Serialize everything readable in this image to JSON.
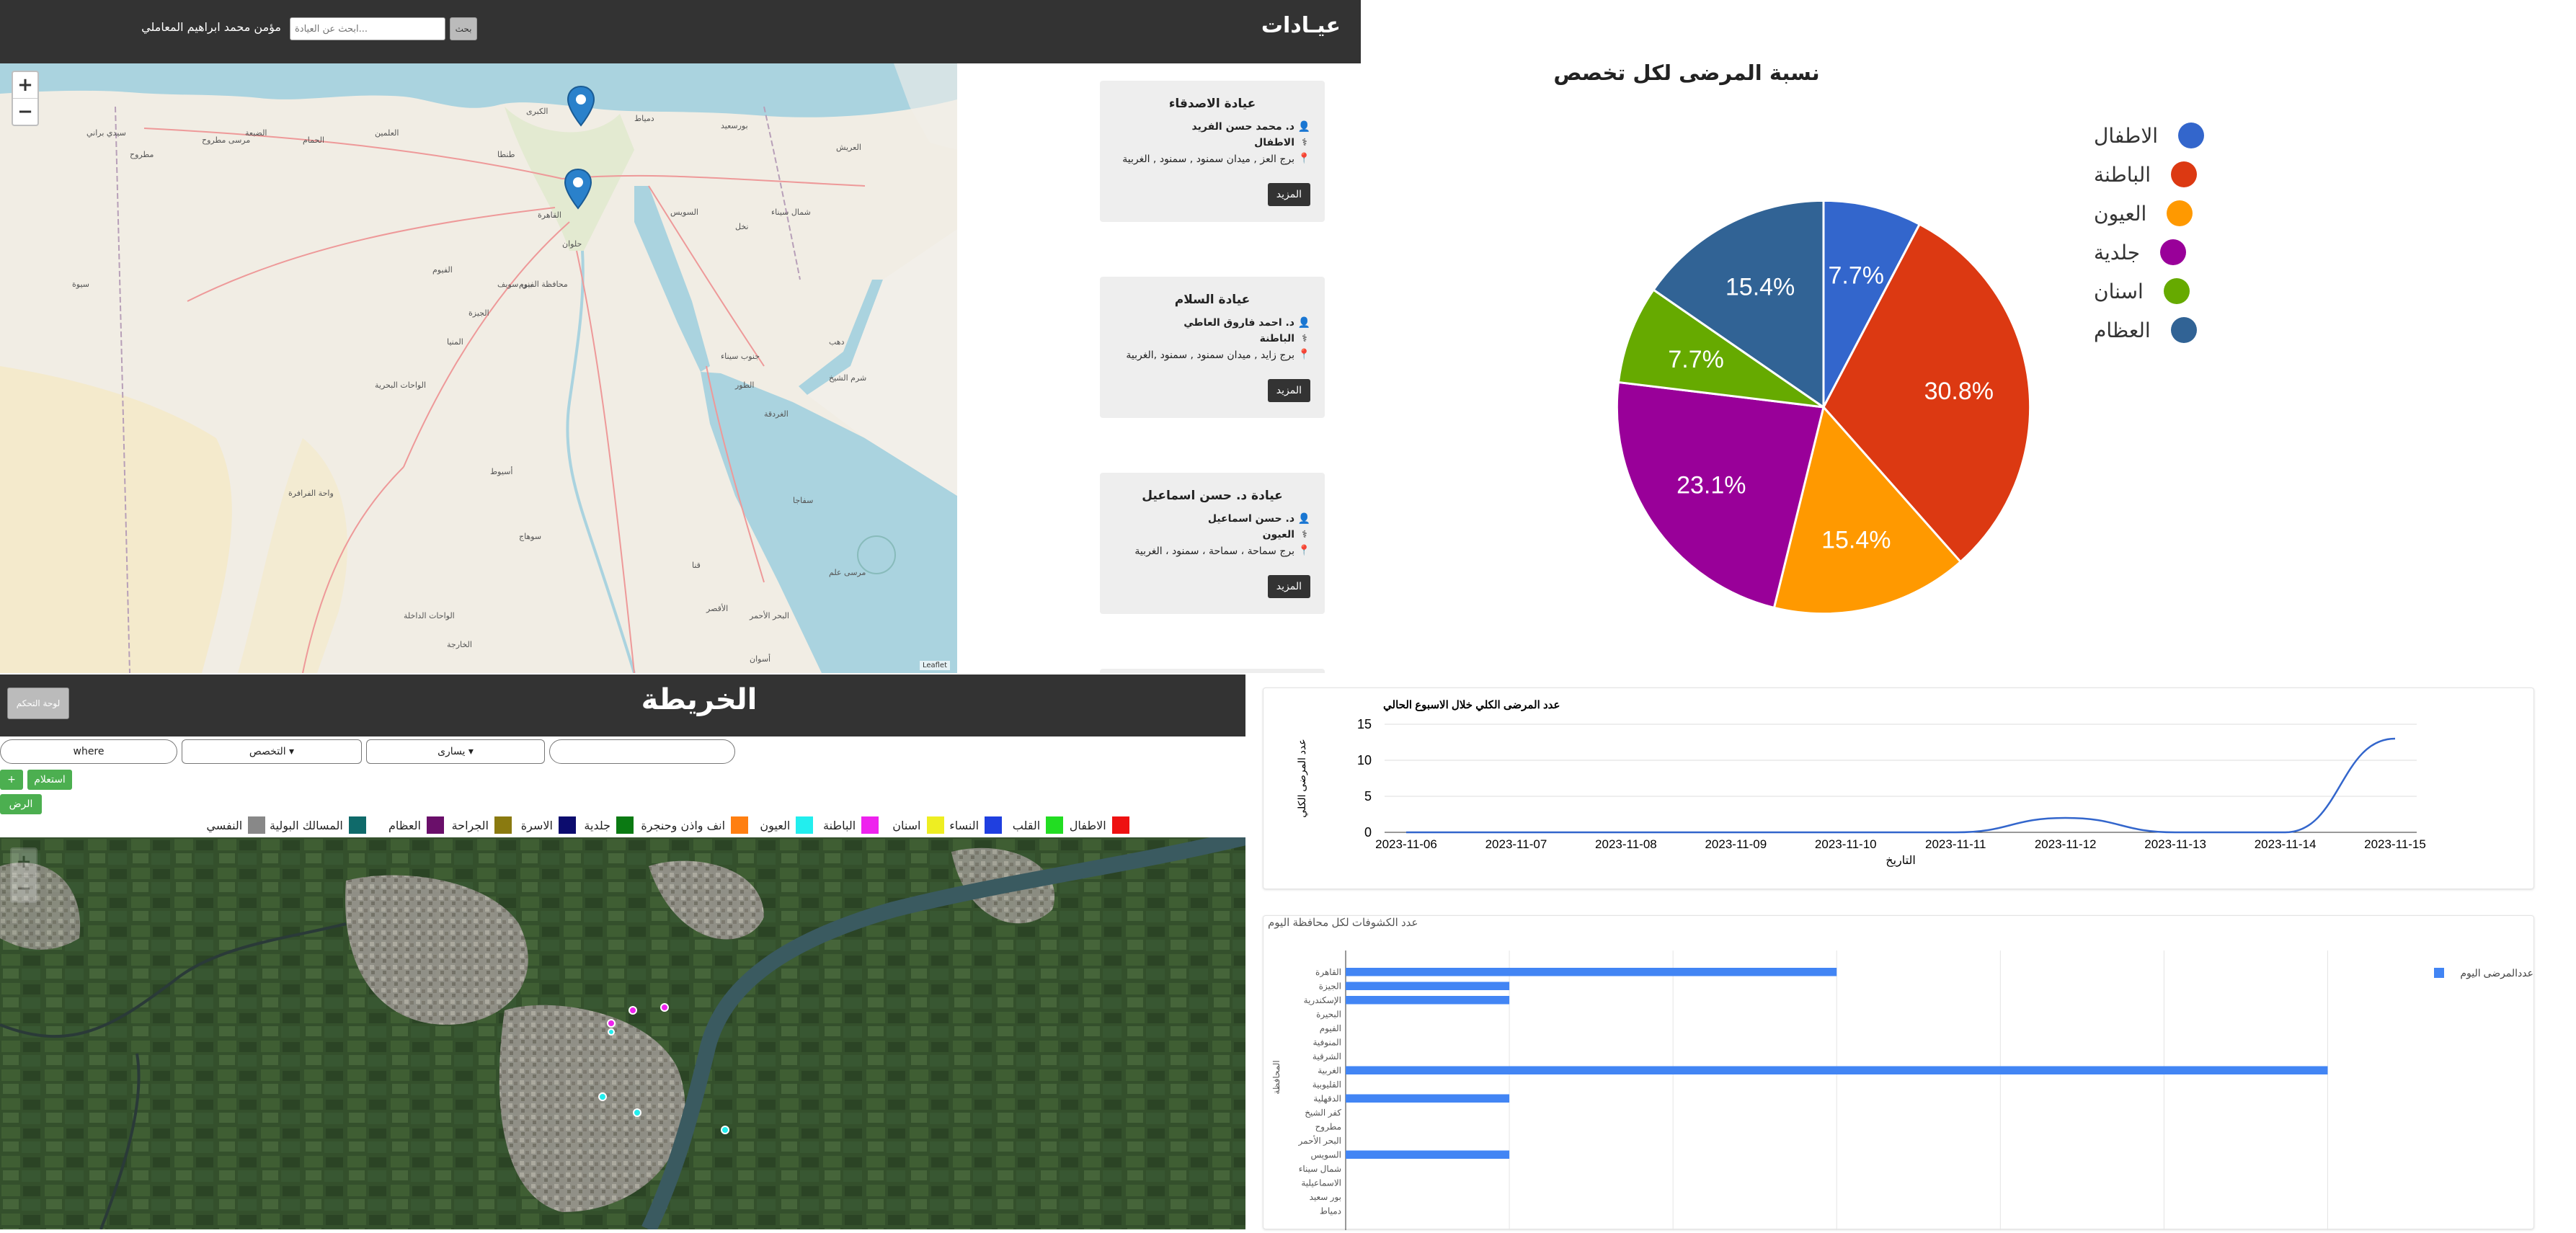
{
  "header": {
    "title": "عيـادات",
    "user_name": "مؤمن محمد ابراهيم المعاملي",
    "search_placeholder": "ابحث عن العيادة...",
    "search_button": "بحث"
  },
  "clinic_map": {
    "zoom_in": "+",
    "zoom_out": "−",
    "place_labels": [
      "الكبرى",
      "القاهرة",
      "حلوان",
      "السويس",
      "طنطا",
      "دمياط",
      "بورسعيد",
      "الفيوم",
      "بني سويف",
      "المنيا",
      "أسيوط",
      "سوهاج",
      "قنا",
      "الأقصر",
      "أسوان",
      "الغردقة",
      "سفاجا",
      "شرم الشيخ",
      "الطور",
      "دهب",
      "نخل",
      "العريش",
      "جنوب سيناء",
      "شمال سيناء",
      "محافظة الفيوم",
      "الجيزة",
      "الواحات البحرية",
      "الواحات الداخلة",
      "الخارجة",
      "واحة الفرافرة",
      "سيوة",
      "مرسى مطروح",
      "مطروح",
      "سيدي براني",
      "الحمام",
      "العلمين",
      "الضبعة",
      "البحر الأحمر",
      "مرسى علم"
    ],
    "attribution": "Leaflet"
  },
  "clinics": [
    {
      "name": "عيادة الاصدقاء",
      "doctor": "د. محمد حسن الفريد",
      "specialty": "الاطفال",
      "address": "برج العز , ميدان سمنود , سمنود , الغربية",
      "more": "المزيد"
    },
    {
      "name": "عيادة السلام",
      "doctor": "د. احمد فاروق العاطي",
      "specialty": "الباطنة",
      "address": "برج زايد , ميدان سمنود , سمنود ,الغربية",
      "more": "المزيد"
    },
    {
      "name": "عيادة د. حسن اسماعيل",
      "doctor": "د. حسن اسماعيل",
      "specialty": "العيون",
      "address": "برج سماحة ، سماحة ، سمنود ، الغربية",
      "more": "المزيد"
    }
  ],
  "pie": {
    "title": "نسبة المرضى لكل تخصص",
    "colors": {
      "accent": "#3366cc"
    }
  },
  "map_section": {
    "title": "الخريطة",
    "dashboard_button": "لوحة التحكم",
    "filters": {
      "where": "where",
      "specialty": "التخصص",
      "time": "يسارى",
      "empty": ""
    },
    "btn_plus": "+",
    "btn_query": "استعلام",
    "btn_show": "الرض",
    "legend": [
      {
        "label": "الاطفال",
        "color": "#ee1111"
      },
      {
        "label": "القلب",
        "color": "#22dd22"
      },
      {
        "label": "النساء",
        "color": "#1f3fe0"
      },
      {
        "label": "اسنان",
        "color": "#eeee22"
      },
      {
        "label": "الباطنة",
        "color": "#ee22ee"
      },
      {
        "label": "العيون",
        "color": "#22eeee"
      },
      {
        "label": "انف واذن وحنجرة",
        "color": "#ff7f11"
      },
      {
        "label": "جلدية",
        "color": "#0b7a13"
      },
      {
        "label": "الاسرة",
        "color": "#0c0c6e"
      },
      {
        "label": "الجراحة",
        "color": "#8a7a10"
      },
      {
        "label": "العظام",
        "color": "#6a0f6a"
      },
      {
        "label": "المسالك البولية",
        "color": "#0f6a6a"
      },
      {
        "label": "النفسي",
        "color": "#888888"
      }
    ],
    "zoom_in": "+",
    "zoom_out": "−"
  },
  "chart_data": [
    {
      "type": "pie",
      "title": "نسبة المرضى لكل تخصص",
      "categories": [
        "الاطفال",
        "الباطنة",
        "العيون",
        "جلدية",
        "اسنان",
        "العظام"
      ],
      "values": [
        7.7,
        30.8,
        15.4,
        23.1,
        7.7,
        15.4
      ],
      "labels": [
        "7.7%",
        "30.8%",
        "15.4%",
        "23.1%",
        "7.7%",
        "15.4%"
      ],
      "colors": [
        "#3366cc",
        "#dc3912",
        "#ff9900",
        "#990099",
        "#66aa00",
        "#316395"
      ],
      "legend_position": "right"
    },
    {
      "type": "line",
      "title": "عدد المرضى الكلي خلال الاسبوع الحالي",
      "xlabel": "التاريخ",
      "ylabel": "عدد المرضى الكلي",
      "x": [
        "2023-11-06",
        "2023-11-07",
        "2023-11-08",
        "2023-11-09",
        "2023-11-10",
        "2023-11-11",
        "2023-11-12",
        "2023-11-13",
        "2023-11-14",
        "2023-11-15"
      ],
      "values": [
        0,
        0,
        0,
        0,
        0,
        0,
        2,
        0,
        0,
        13
      ],
      "yticks": [
        0,
        5,
        10,
        15
      ],
      "ylim": [
        0,
        15
      ],
      "grid": true,
      "color": "#3366cc"
    },
    {
      "type": "bar",
      "title": "عدد الكشوفات لكل محافظة اليوم",
      "ylabel": "المحافظة",
      "categories": [
        "القاهرة",
        "الجيزة",
        "الإسكندرية",
        "البحيرة",
        "الفيوم",
        "المنوفية",
        "الشرقية",
        "الغربية",
        "القليوبية",
        "الدقهلية",
        "كفر الشيخ",
        "مطروح",
        "البحر الأحمر",
        "السويس",
        "شمال سيناء",
        "الاسماعيلية",
        "بور سعيد",
        "دمياط"
      ],
      "series": [
        {
          "name": "عددالمرضى اليوم",
          "values": [
            3,
            1,
            1,
            0,
            0,
            0,
            0,
            6,
            0,
            1,
            0,
            0,
            0,
            1,
            0,
            0,
            0,
            0
          ]
        }
      ],
      "xlim": [
        0,
        6.5
      ],
      "grid": true,
      "color": "#4285f4",
      "legend_position": "right"
    }
  ]
}
